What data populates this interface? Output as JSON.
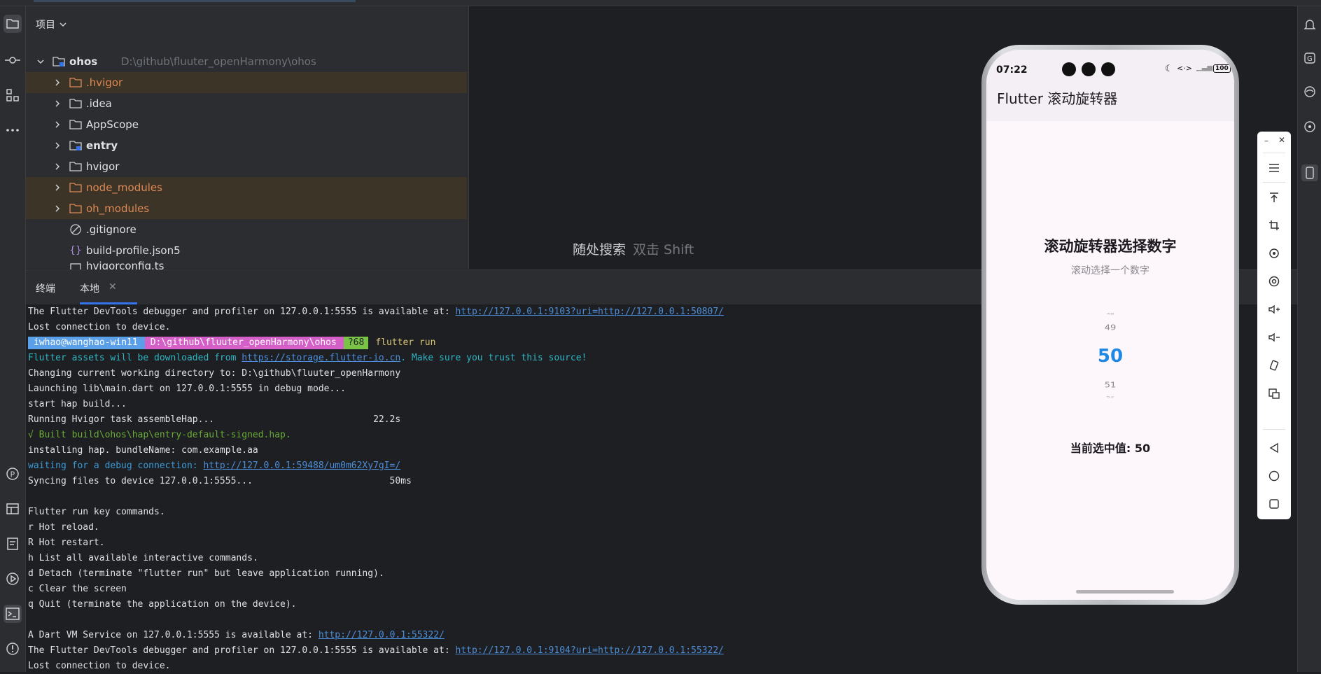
{
  "project": {
    "header": "项目",
    "items": [
      {
        "label": "ohos",
        "path": "D:\\github\\fluuter_openHarmony\\ohos",
        "type": "root"
      },
      {
        "label": ".hvigor",
        "type": "folder-excluded"
      },
      {
        "label": ".idea",
        "type": "folder"
      },
      {
        "label": "AppScope",
        "type": "folder"
      },
      {
        "label": "entry",
        "type": "module"
      },
      {
        "label": "hvigor",
        "type": "folder"
      },
      {
        "label": "node_modules",
        "type": "folder-excluded"
      },
      {
        "label": "oh_modules",
        "type": "folder-excluded"
      },
      {
        "label": ".gitignore",
        "type": "file"
      },
      {
        "label": "build-profile.json5",
        "type": "file"
      },
      {
        "label": "hvigorconfig.ts",
        "type": "file"
      }
    ]
  },
  "editor": {
    "search_hint": "随处搜索",
    "search_shortcut": "双击 Shift"
  },
  "terminal": {
    "tab_title": "终端",
    "tab_local": "本地",
    "prompt": {
      "user": "iwhao@wanghao-win11",
      "path": "D:\\github\\fluuter_openHarmony\\ohos",
      "branch": "?68",
      "command": "flutter run"
    },
    "lines": {
      "l0_text": "The Flutter DevTools debugger and profiler on 127.0.0.1:5555 is available at: ",
      "l0_link": "http://127.0.0.1:9103?uri=http://127.0.0.1:50807/",
      "l1": "Lost connection to device.",
      "l3_text": "Flutter assets will be downloaded from ",
      "l3_link": "https://storage.flutter-io.cn",
      "l3_tail": ". Make sure you trust this source!",
      "l4": "Changing current working directory to: D:\\github\\fluuter_openHarmony",
      "l5": "Launching lib\\main.dart on 127.0.0.1:5555 in debug mode...",
      "l6": "start hap build...",
      "l7": "Running Hvigor task assembleHap...                             22.2s",
      "l8": "√ Built build\\ohos\\hap\\entry-default-signed.hap.",
      "l9": "installing hap. bundleName: com.example.aa",
      "l10_text": "waiting for a debug connection: ",
      "l10_link": "http://127.0.0.1:59488/um0m62Xy7gI=/",
      "l11": "Syncing files to device 127.0.0.1:5555...                         50ms",
      "l13": "Flutter run key commands.",
      "l14": "r Hot reload.",
      "l15": "R Hot restart.",
      "l16": "h List all available interactive commands.",
      "l17": "d Detach (terminate \"flutter run\" but leave application running).",
      "l18": "c Clear the screen",
      "l19": "q Quit (terminate the application on the device).",
      "l21_text": "A Dart VM Service on 127.0.0.1:5555 is available at: ",
      "l21_link": "http://127.0.0.1:55322/",
      "l22_text": "The Flutter DevTools debugger and profiler on 127.0.0.1:5555 is available at: ",
      "l22_link": "http://127.0.0.1:9104?uri=http://127.0.0.1:55322/",
      "l23": "Lost connection to device."
    }
  },
  "phone": {
    "time": "07:22",
    "battery": "100",
    "app_title": "Flutter 滚动旋转器",
    "heading": "滚动旋转器选择数字",
    "subtitle": "滚动选择一个数字",
    "wheel": {
      "above2": "48",
      "above1": "49",
      "selected": "50",
      "below1": "51",
      "below2": "52"
    },
    "current_label": "当前选中值: 50"
  },
  "colors": {
    "accent": "#3574f0",
    "selected_number": "#1e88e5",
    "excluded_folder": "#e08855"
  }
}
